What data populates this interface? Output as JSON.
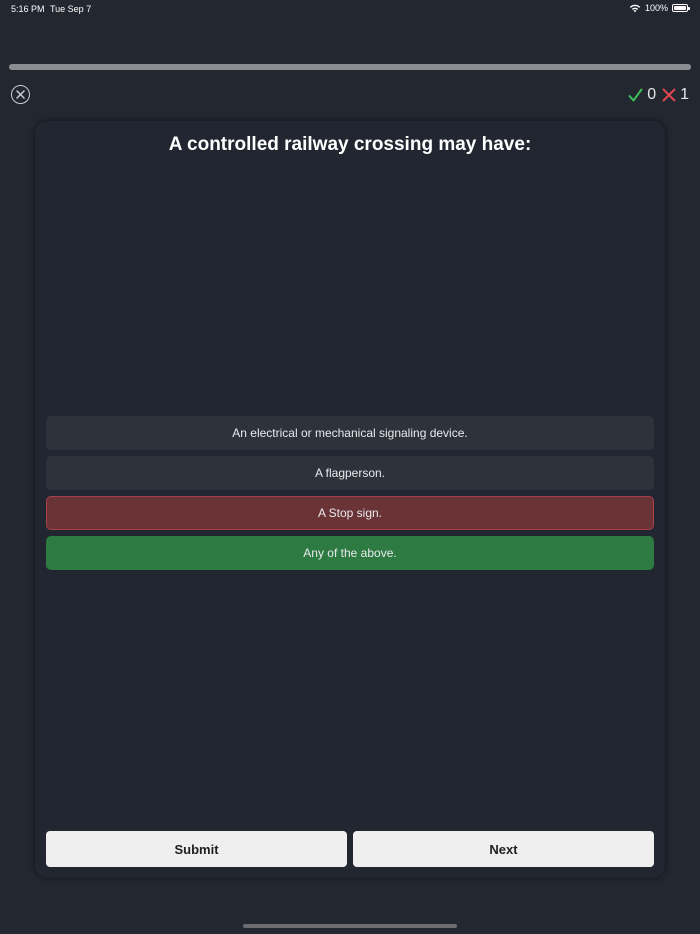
{
  "status_bar": {
    "time": "5:16 PM",
    "date": "Tue Sep 7",
    "battery": "100%"
  },
  "progress": {
    "fraction": 1.0
  },
  "score": {
    "correct": "0",
    "incorrect": "1",
    "correct_color": "#3fbf5a",
    "incorrect_color": "#e0464f"
  },
  "question": {
    "text": "A controlled railway crossing may have:"
  },
  "answers": [
    {
      "label": "An electrical or mechanical signaling device.",
      "state": "neutral"
    },
    {
      "label": "A flagperson.",
      "state": "neutral"
    },
    {
      "label": "A Stop sign.",
      "state": "wrong"
    },
    {
      "label": "Any of the above.",
      "state": "correct"
    }
  ],
  "actions": {
    "submit_label": "Submit",
    "next_label": "Next"
  },
  "icons": {
    "close": "close-circle-icon",
    "check": "checkmark-icon",
    "cross": "cross-icon",
    "wifi": "wifi-icon",
    "battery": "battery-icon"
  }
}
